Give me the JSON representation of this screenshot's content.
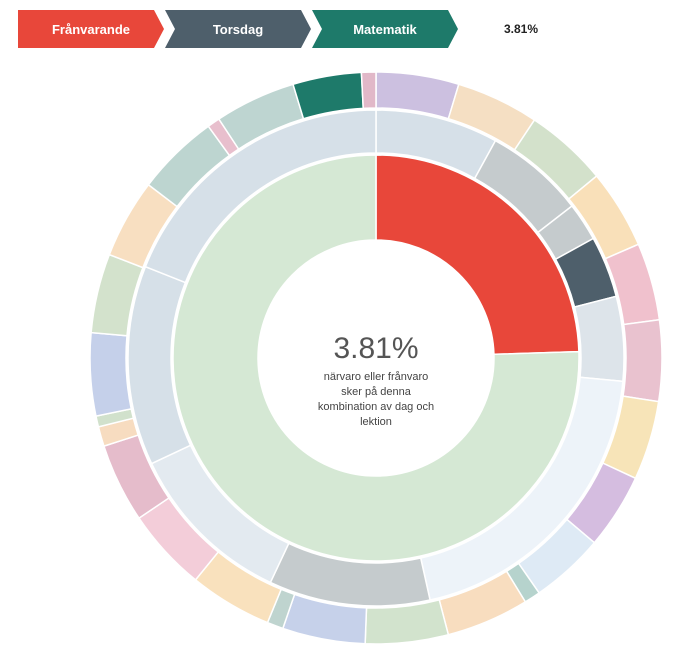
{
  "breadcrumb": {
    "items": [
      {
        "label": "Frånvarande",
        "color": "#e8473a"
      },
      {
        "label": "Torsdag",
        "color": "#4e5f6b"
      },
      {
        "label": "Matematik",
        "color": "#1e7a6a"
      }
    ],
    "percentage": "3.81%"
  },
  "center": {
    "percentage": "3.81%",
    "description_lines": [
      "närvaro eller frånvaro",
      "sker på denna",
      "kombination av dag och",
      "lektion"
    ]
  },
  "chart_data": {
    "type": "sunburst",
    "unit": "%",
    "rings": [
      {
        "level": "status",
        "segments": [
          {
            "name": "Frånvarande",
            "value": 24.5,
            "color": "#e8473a"
          },
          {
            "name": "",
            "value": 75.5,
            "color": "#d5e8d4"
          }
        ]
      },
      {
        "level": "dag",
        "segments": [
          {
            "name": "",
            "value": 8.0,
            "color": "#d6e0e8"
          },
          {
            "name": "",
            "value": 6.5,
            "color": "#c5cbcd"
          },
          {
            "name": "",
            "value": 2.5,
            "color": "#c5cbcd"
          },
          {
            "name": "Torsdag",
            "value": 4.0,
            "color": "#4e5f6b"
          },
          {
            "name": "",
            "value": 5.5,
            "color": "#dde4ea"
          },
          {
            "name": "",
            "value": 20.0,
            "color": "#edf3f9"
          },
          {
            "name": "",
            "value": 10.5,
            "color": "#c5cbcd"
          },
          {
            "name": "",
            "value": 11.0,
            "color": "#e3eaf0"
          },
          {
            "name": "",
            "value": 13.0,
            "color": "#d6e0e8"
          },
          {
            "name": "",
            "value": 19.0,
            "color": "#d6e0e8"
          }
        ]
      },
      {
        "level": "lektion",
        "segments": [
          {
            "name": "",
            "value": 4.6,
            "color": "#ccc0e0"
          },
          {
            "name": "",
            "value": 4.6,
            "color": "#f5dfc3"
          },
          {
            "name": "",
            "value": 4.6,
            "color": "#d3e1cb"
          },
          {
            "name": "",
            "value": 4.4,
            "color": "#f9e0b9"
          },
          {
            "name": "",
            "value": 4.3,
            "color": "#f0c1cd"
          },
          {
            "name": "",
            "value": 4.5,
            "color": "#e9c2cf"
          },
          {
            "name": "",
            "value": 4.4,
            "color": "#f7e4b8"
          },
          {
            "name": "",
            "value": 4.2,
            "color": "#d5bde0"
          },
          {
            "name": "",
            "value": 4.1,
            "color": "#deeaf5"
          },
          {
            "name": "",
            "value": 0.9,
            "color": "#b6d3cd"
          },
          {
            "name": "",
            "value": 4.6,
            "color": "#f8ddbf"
          },
          {
            "name": "",
            "value": 4.6,
            "color": "#d2e3cd"
          },
          {
            "name": "",
            "value": 4.6,
            "color": "#c6d1ea"
          },
          {
            "name": "",
            "value": 0.9,
            "color": "#bfd4cf"
          },
          {
            "name": "",
            "value": 4.6,
            "color": "#f9e1bd"
          },
          {
            "name": "",
            "value": 4.6,
            "color": "#f3cdd9"
          },
          {
            "name": "",
            "value": 4.4,
            "color": "#e5bccb"
          },
          {
            "name": "",
            "value": 1.1,
            "color": "#f7dcc0"
          },
          {
            "name": "",
            "value": 0.6,
            "color": "#d1e1cc"
          },
          {
            "name": "",
            "value": 4.6,
            "color": "#c5d0ea"
          },
          {
            "name": "",
            "value": 4.4,
            "color": "#d3e2cc"
          },
          {
            "name": "",
            "value": 4.4,
            "color": "#f8dfc1"
          },
          {
            "name": "",
            "value": 4.6,
            "color": "#bdd5d0"
          },
          {
            "name": "",
            "value": 0.7,
            "color": "#e8bfcd"
          },
          {
            "name": "",
            "value": 4.5,
            "color": "#bed5d1"
          },
          {
            "name": "Matematik",
            "value": 3.81,
            "color": "#1e7a6a"
          },
          {
            "name": "",
            "value": 0.8,
            "color": "#e1b8c8"
          }
        ]
      }
    ]
  }
}
